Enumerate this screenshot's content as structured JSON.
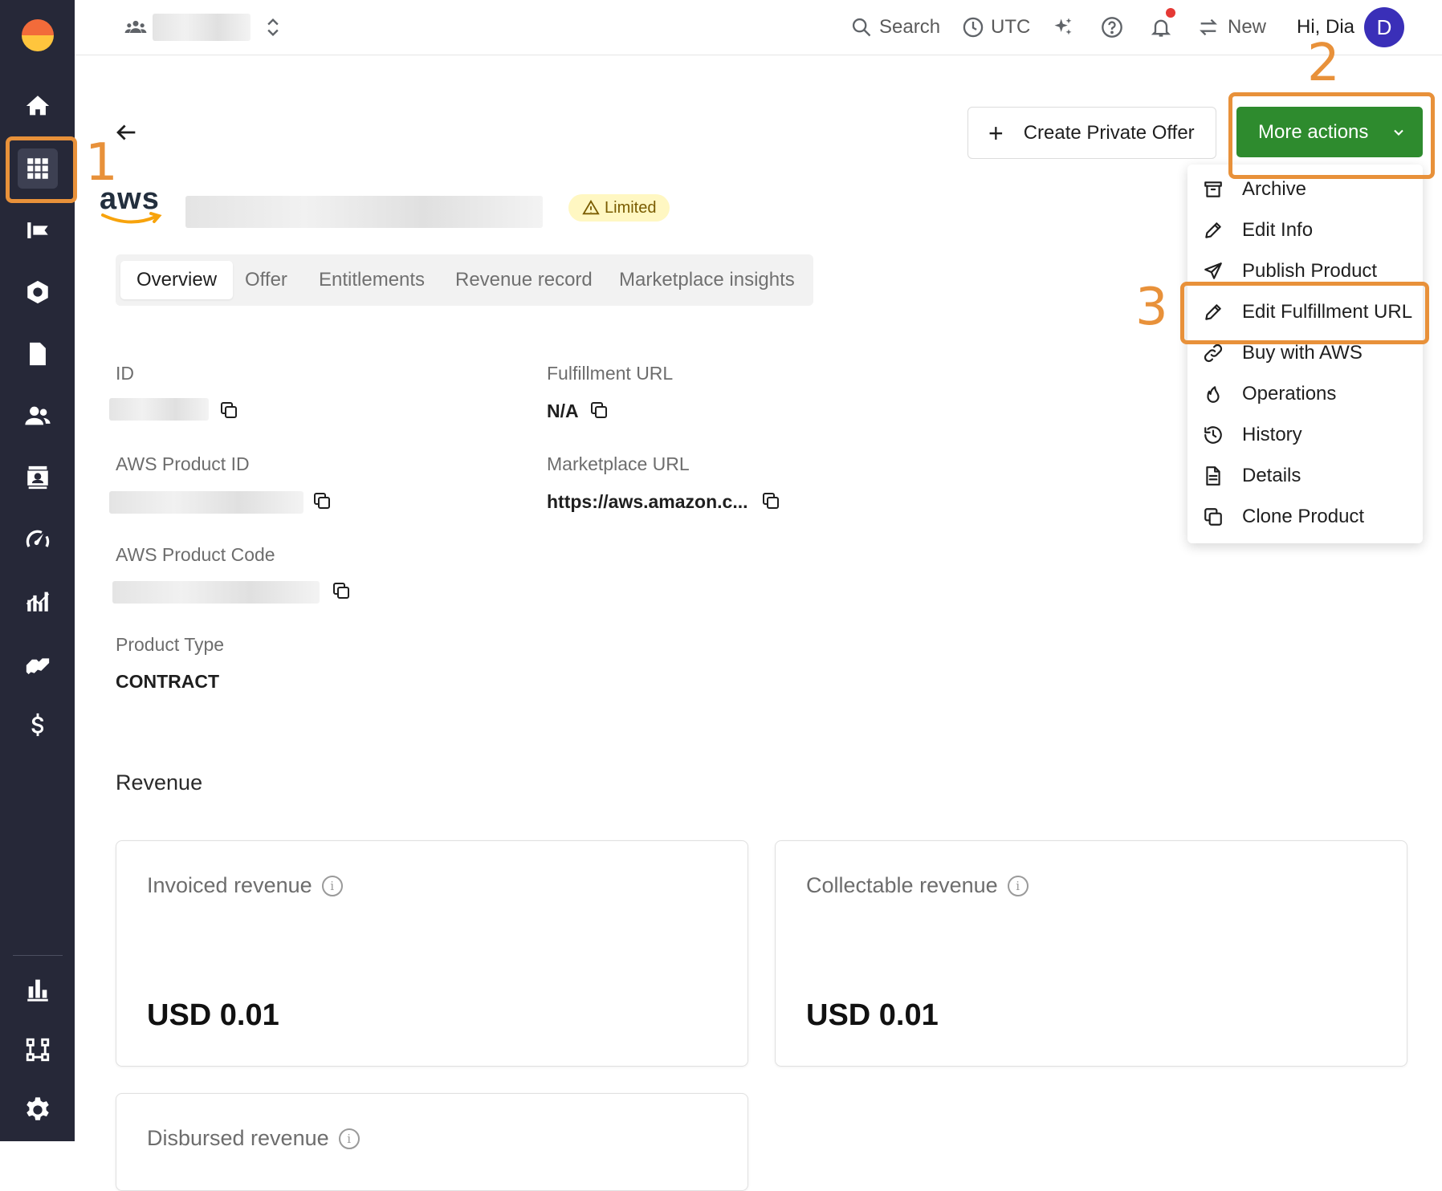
{
  "topbar": {
    "search_label": "Search",
    "timezone_label": "UTC",
    "new_label": "New",
    "greeting": "Hi, Dia",
    "avatar_initial": "D"
  },
  "header": {
    "create_offer_label": "Create Private Offer",
    "more_actions_label": "More actions",
    "status_badge": "Limited",
    "logo_text": "aws"
  },
  "tabs": [
    "Overview",
    "Offer",
    "Entitlements",
    "Revenue record",
    "Marketplace insights"
  ],
  "fields": {
    "id_label": "ID",
    "fulfillment_url_label": "Fulfillment URL",
    "fulfillment_url_value": "N/A",
    "aws_product_id_label": "AWS Product ID",
    "marketplace_url_label": "Marketplace URL",
    "marketplace_url_value": "https://aws.amazon.c...",
    "aws_product_code_label": "AWS Product Code",
    "product_type_label": "Product Type",
    "product_type_value": "CONTRACT"
  },
  "revenue": {
    "section_title": "Revenue",
    "invoiced_label": "Invoiced revenue",
    "invoiced_value": "USD 0.01",
    "collectable_label": "Collectable revenue",
    "collectable_value": "USD 0.01",
    "disbursed_label": "Disbursed revenue"
  },
  "menu": [
    {
      "label": "Archive",
      "icon": "archive-icon"
    },
    {
      "label": "Edit Info",
      "icon": "pencil-icon"
    },
    {
      "label": "Publish Product",
      "icon": "send-icon"
    },
    {
      "label": "Edit Fulfillment URL",
      "icon": "pencil-icon"
    },
    {
      "label": "Buy with AWS",
      "icon": "link-icon"
    },
    {
      "label": "Operations",
      "icon": "flame-icon"
    },
    {
      "label": "History",
      "icon": "history-icon"
    },
    {
      "label": "Details",
      "icon": "document-icon"
    },
    {
      "label": "Clone Product",
      "icon": "copy-icon"
    }
  ],
  "annotations": [
    "1",
    "2",
    "3"
  ],
  "colors": {
    "sidebar": "#262838",
    "primary_button": "#2e8b2e",
    "highlight": "#e8913a",
    "avatar": "#3a2fb8",
    "badge_bg": "#fff7c2"
  }
}
